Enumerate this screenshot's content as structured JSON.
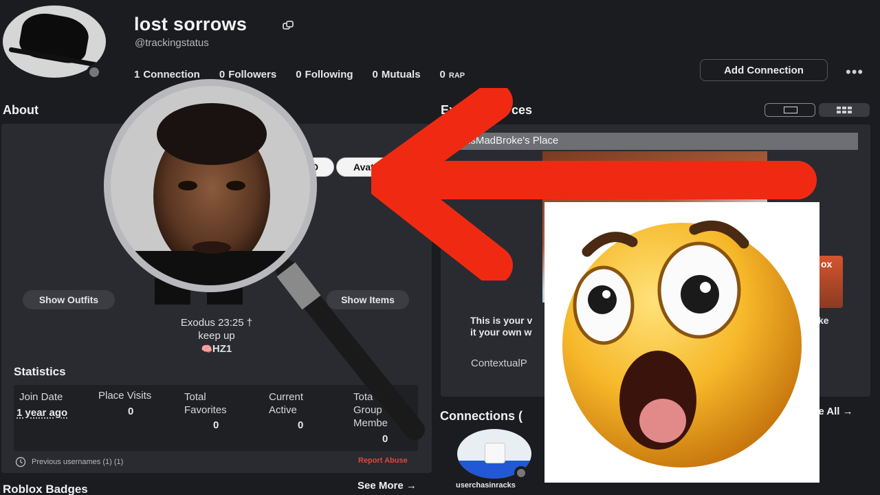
{
  "profile": {
    "display_name": "lost sorrows",
    "username": "@trackingstatus",
    "stats": [
      {
        "num": "1",
        "label": "Connection"
      },
      {
        "num": "0",
        "label": "Followers"
      },
      {
        "num": "0",
        "label": "Following"
      },
      {
        "num": "0",
        "label": "Mutuals"
      },
      {
        "num": "0",
        "label": "RAP"
      }
    ],
    "add_connection_label": "Add Connection",
    "more_label": "•••"
  },
  "about": {
    "title": "About",
    "pill_partial_left": "D",
    "pill_partial_avatar": "Avat",
    "show_outfits": "Show Outfits",
    "show_items": "Show Items",
    "bio_line1": "Exodus 23:25 †",
    "bio_line2": "keep up",
    "bio_line3": "HZ1"
  },
  "statistics": {
    "title": "Statistics",
    "columns": [
      {
        "label": "Join Date",
        "value": "1 year ago"
      },
      {
        "label": "Place Visits",
        "value": "0"
      },
      {
        "label1": "Total",
        "label2": "Favorites",
        "value": "0"
      },
      {
        "label1": "Current",
        "label2": "Active",
        "value": "0"
      },
      {
        "label1": "Tota",
        "label2": "Group",
        "label3": "Membe",
        "value": "0"
      }
    ],
    "previous_usernames": "Previous usernames (1) (1)",
    "report_abuse": "Report Abuse"
  },
  "badges": {
    "title": "Roblox Badges",
    "see_more": "See More →"
  },
  "experiences": {
    "title_partial_left": "Ex",
    "title_partial_right": "ces",
    "place_name": "hsMadBroke's Place",
    "mini_label": "ox",
    "desc_line1": "This is your v",
    "desc_line1_right": "ke",
    "desc_line2": "it your own w",
    "creator_partial": "ContextualP"
  },
  "connections": {
    "title": "Connections (",
    "see_all": "ee All →",
    "items": [
      {
        "name": "userchasinracks"
      }
    ]
  },
  "colors": {
    "background": "#1b1c20",
    "panel": "#2a2b30",
    "report_abuse": "#e0463c",
    "arrow": "#f02a12",
    "connection_avatar_base": "#2257d6"
  }
}
